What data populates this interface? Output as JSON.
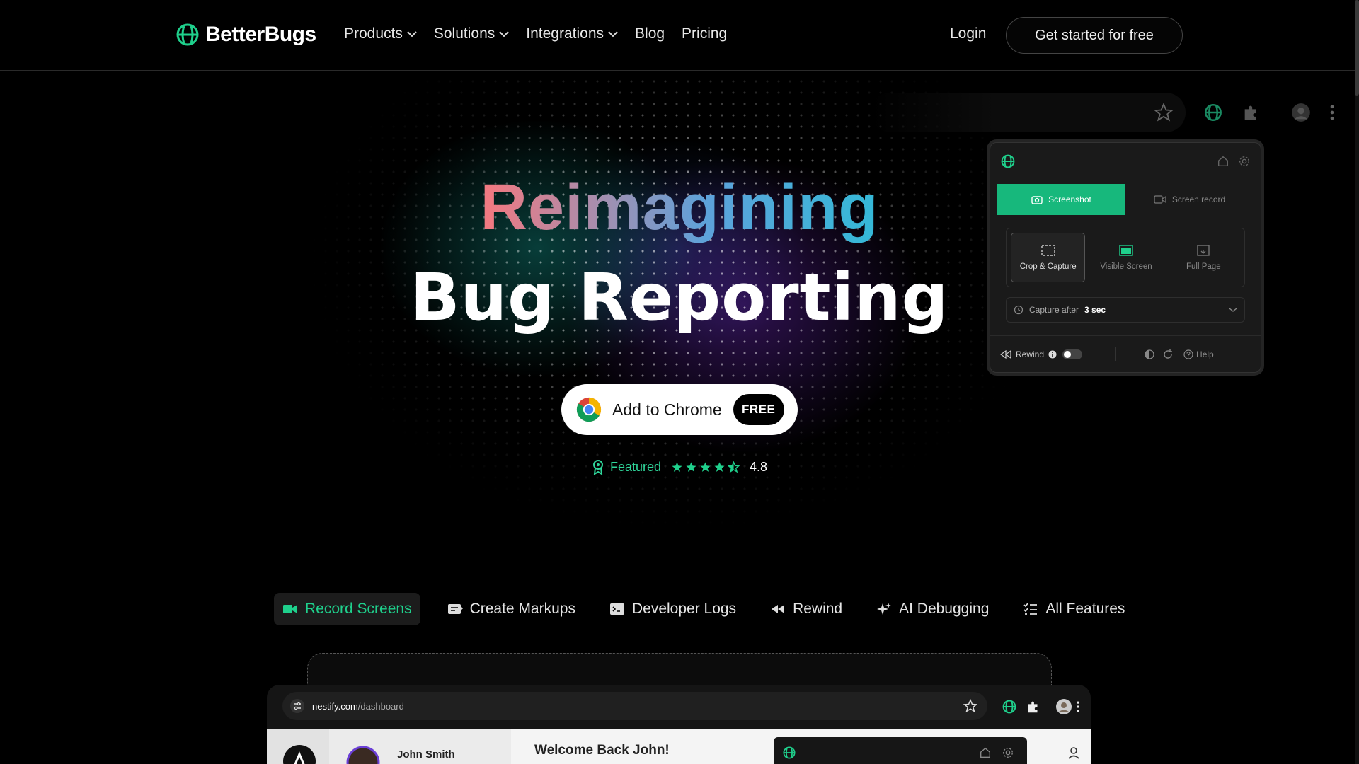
{
  "nav": {
    "brand": "BetterBugs",
    "menu": [
      {
        "label": "Products",
        "dropdown": true
      },
      {
        "label": "Solutions",
        "dropdown": true
      },
      {
        "label": "Integrations",
        "dropdown": true
      },
      {
        "label": "Blog",
        "dropdown": false
      },
      {
        "label": "Pricing",
        "dropdown": false
      }
    ],
    "login": "Login",
    "cta": "Get started for free"
  },
  "hero": {
    "title_line1": "Reimagining",
    "title_line2": "Bug Reporting",
    "chrome_button": "Add to Chrome",
    "free_badge": "FREE",
    "featured_label": "Featured",
    "rating": "4.8",
    "stars": 4.5
  },
  "extension": {
    "tabs": [
      "Screenshot",
      "Screen record"
    ],
    "active_tab": "Screenshot",
    "modes": [
      "Crop & Capture",
      "Visible Screen",
      "Full Page"
    ],
    "active_mode": "Crop & Capture",
    "delay_prefix": "Capture after",
    "delay_value": "3 sec",
    "rewind_label": "Rewind",
    "help_label": "Help"
  },
  "feature_tabs": [
    {
      "label": "Record Screens",
      "icon": "video-camera-icon",
      "active": true
    },
    {
      "label": "Create Markups",
      "icon": "markup-icon",
      "active": false
    },
    {
      "label": "Developer Logs",
      "icon": "terminal-icon",
      "active": false
    },
    {
      "label": "Rewind",
      "icon": "rewind-icon",
      "active": false
    },
    {
      "label": "AI Debugging",
      "icon": "sparkles-icon",
      "active": false
    },
    {
      "label": "All Features",
      "icon": "checklist-icon",
      "active": false
    }
  ],
  "demo": {
    "url_host": "nestify.com",
    "url_path": "/dashboard",
    "user_name": "John Smith",
    "welcome": "Welcome Back John!"
  },
  "colors": {
    "accent": "#1fd08c",
    "background": "#000000",
    "button_text": "#111111"
  }
}
